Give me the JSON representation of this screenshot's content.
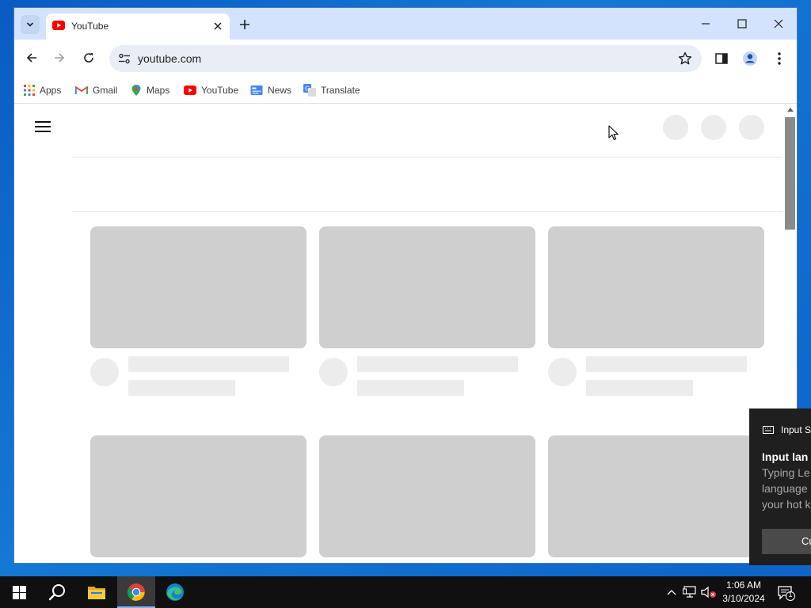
{
  "browser": {
    "tab": {
      "title": "YouTube"
    },
    "address_bar": {
      "url": "youtube.com"
    },
    "bookmarks": [
      {
        "label": "Apps",
        "icon": "apps-grid-icon"
      },
      {
        "label": "Gmail",
        "icon": "gmail-icon"
      },
      {
        "label": "Maps",
        "icon": "maps-icon"
      },
      {
        "label": "YouTube",
        "icon": "youtube-icon"
      },
      {
        "label": "News",
        "icon": "news-icon"
      },
      {
        "label": "Translate",
        "icon": "translate-icon"
      }
    ]
  },
  "page": {
    "state": "loading-skeleton",
    "video_card_rows": 2,
    "video_cards_per_row": 3
  },
  "notification": {
    "app_name": "Input S",
    "heading": "Input lan",
    "body_lines": [
      "Typing Le",
      "language",
      "your hot k"
    ],
    "action_label": "Cu"
  },
  "taskbar": {
    "pinned": [
      "start-icon",
      "search-icon",
      "file-explorer-icon",
      "chrome-icon",
      "edge-icon"
    ],
    "active": "chrome-icon",
    "clock": {
      "time": "1:06 AM",
      "date": "3/10/2024"
    },
    "notification_count": "1"
  },
  "colors": {
    "titlebar": "#d3e3fd",
    "omnibox": "#e9eef6",
    "skeleton_thumb": "#cfcfcf",
    "skeleton_line": "#ececec",
    "youtube_red": "#ff0000",
    "taskbar": "#101010",
    "desktop": "#0d63c9"
  }
}
